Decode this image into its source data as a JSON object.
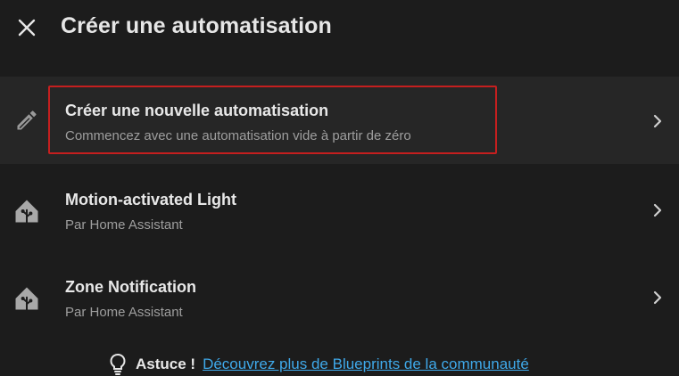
{
  "dialog": {
    "title": "Créer une automatisation",
    "close_icon": "close-icon"
  },
  "options": [
    {
      "primary": "Créer une nouvelle automatisation",
      "secondary": "Commencez avec une automatisation vide à partir de zéro",
      "icon": "pencil-icon"
    },
    {
      "primary": "Motion-activated Light",
      "secondary": "Par Home Assistant",
      "icon": "home-assistant-blueprint-icon"
    },
    {
      "primary": "Zone Notification",
      "secondary": "Par Home Assistant",
      "icon": "home-assistant-blueprint-icon"
    }
  ],
  "tip": {
    "label": "Astuce !",
    "link_text": "Découvrez plus de Blueprints de la communauté",
    "icon": "lightbulb-icon"
  },
  "colors": {
    "background": "#1c1c1c",
    "highlighted_row": "#262626",
    "highlight_border": "#c51f1f",
    "link": "#3fa9ea"
  }
}
